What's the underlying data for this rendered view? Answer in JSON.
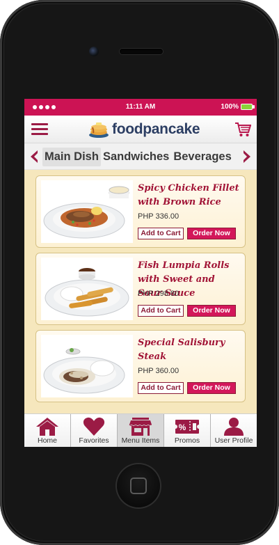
{
  "status_bar": {
    "time": "11:11 AM",
    "battery": "100%"
  },
  "header": {
    "brand": "foodpancake"
  },
  "categories": [
    "Main Dish",
    "Sandwiches",
    "Beverages"
  ],
  "dishes": [
    {
      "name": "Spicy Chicken Fillet with Brown Rice",
      "price": "PHP 336.00",
      "add_label": "Add to Cart",
      "order_label": "Order Now"
    },
    {
      "name": "Fish Lumpia Rolls with Sweet and Sour Sauce",
      "price": "PHP 298.80",
      "add_label": "Add to Cart",
      "order_label": "Order Now"
    },
    {
      "name": "Special Salisbury Steak",
      "price": "PHP 360.00",
      "add_label": "Add to Cart",
      "order_label": "Order Now"
    }
  ],
  "tabs": [
    {
      "label": "Home",
      "icon": "home-icon"
    },
    {
      "label": "Favorites",
      "icon": "heart-icon"
    },
    {
      "label": "Menu Items",
      "icon": "store-icon"
    },
    {
      "label": "Promos",
      "icon": "ticket-icon"
    },
    {
      "label": "User Profile",
      "icon": "user-icon"
    }
  ],
  "colors": {
    "accent": "#cc1354",
    "brand_dark": "#9b1b45",
    "cream": "#f6e7bd"
  }
}
